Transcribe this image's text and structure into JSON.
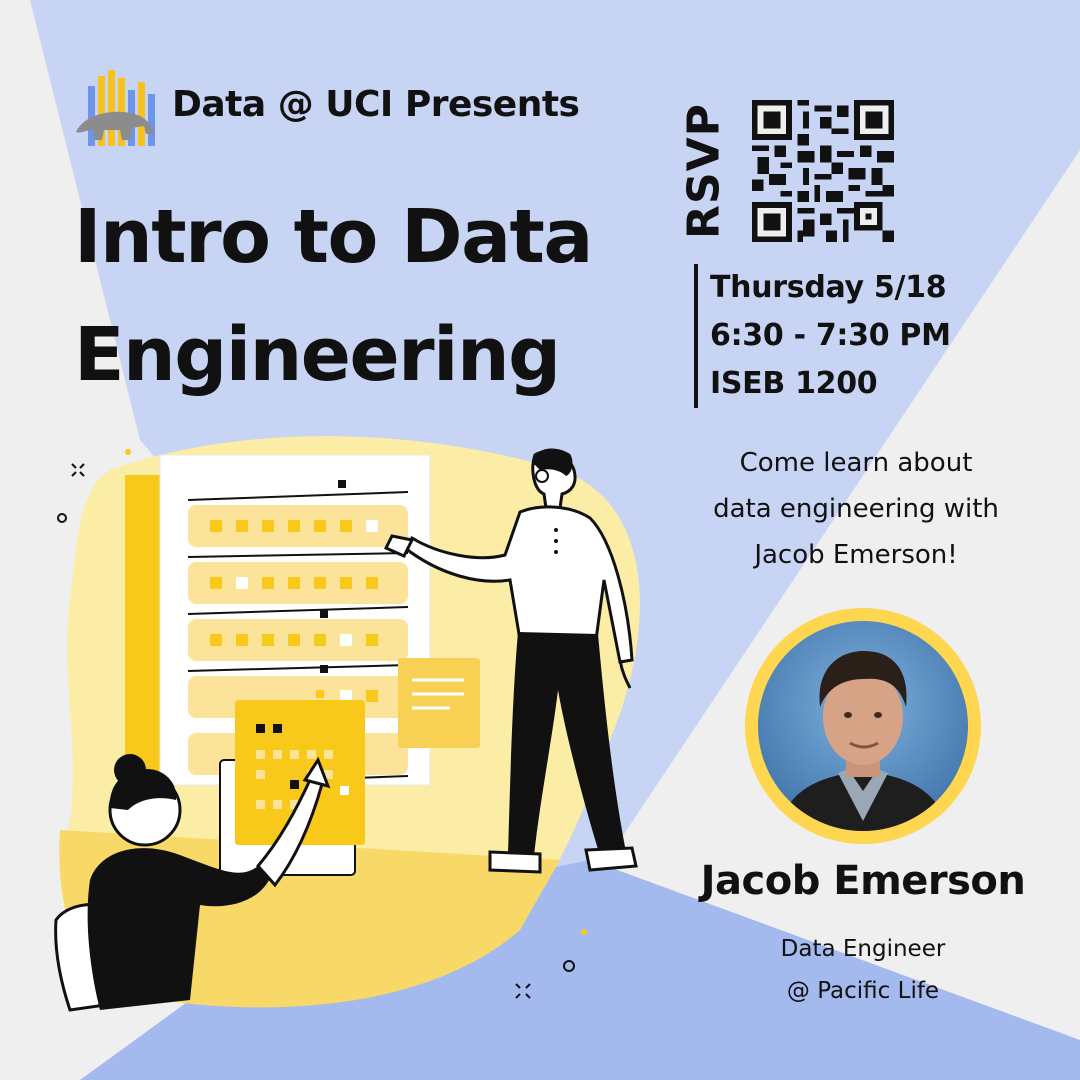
{
  "header": {
    "presents": "Data @ UCI Presents",
    "title_line1": "Intro to Data",
    "title_line2": "Engineering",
    "logo_icon": "anteater-bar-chart-logo"
  },
  "rsvp": {
    "label": "RSVP",
    "qr_icon": "qr-code-icon"
  },
  "event": {
    "date": "Thursday 5/18",
    "time": "6:30 - 7:30 PM",
    "location": "ISEB 1200"
  },
  "description": {
    "line1": "Come learn about",
    "line2": "data engineering with",
    "line3": "Jacob Emerson!"
  },
  "speaker": {
    "name": "Jacob Emerson",
    "role_line1": "Data Engineer",
    "role_line2": "@ Pacific Life",
    "photo_icon": "speaker-photo"
  },
  "colors": {
    "background": "#efefef",
    "blue_light": "#c7d4f3",
    "blue_mid": "#a4b9ee",
    "yellow": "#f8c81a",
    "yellow_light": "#fbeca6",
    "ring": "#ffd64f",
    "text": "#111111"
  }
}
